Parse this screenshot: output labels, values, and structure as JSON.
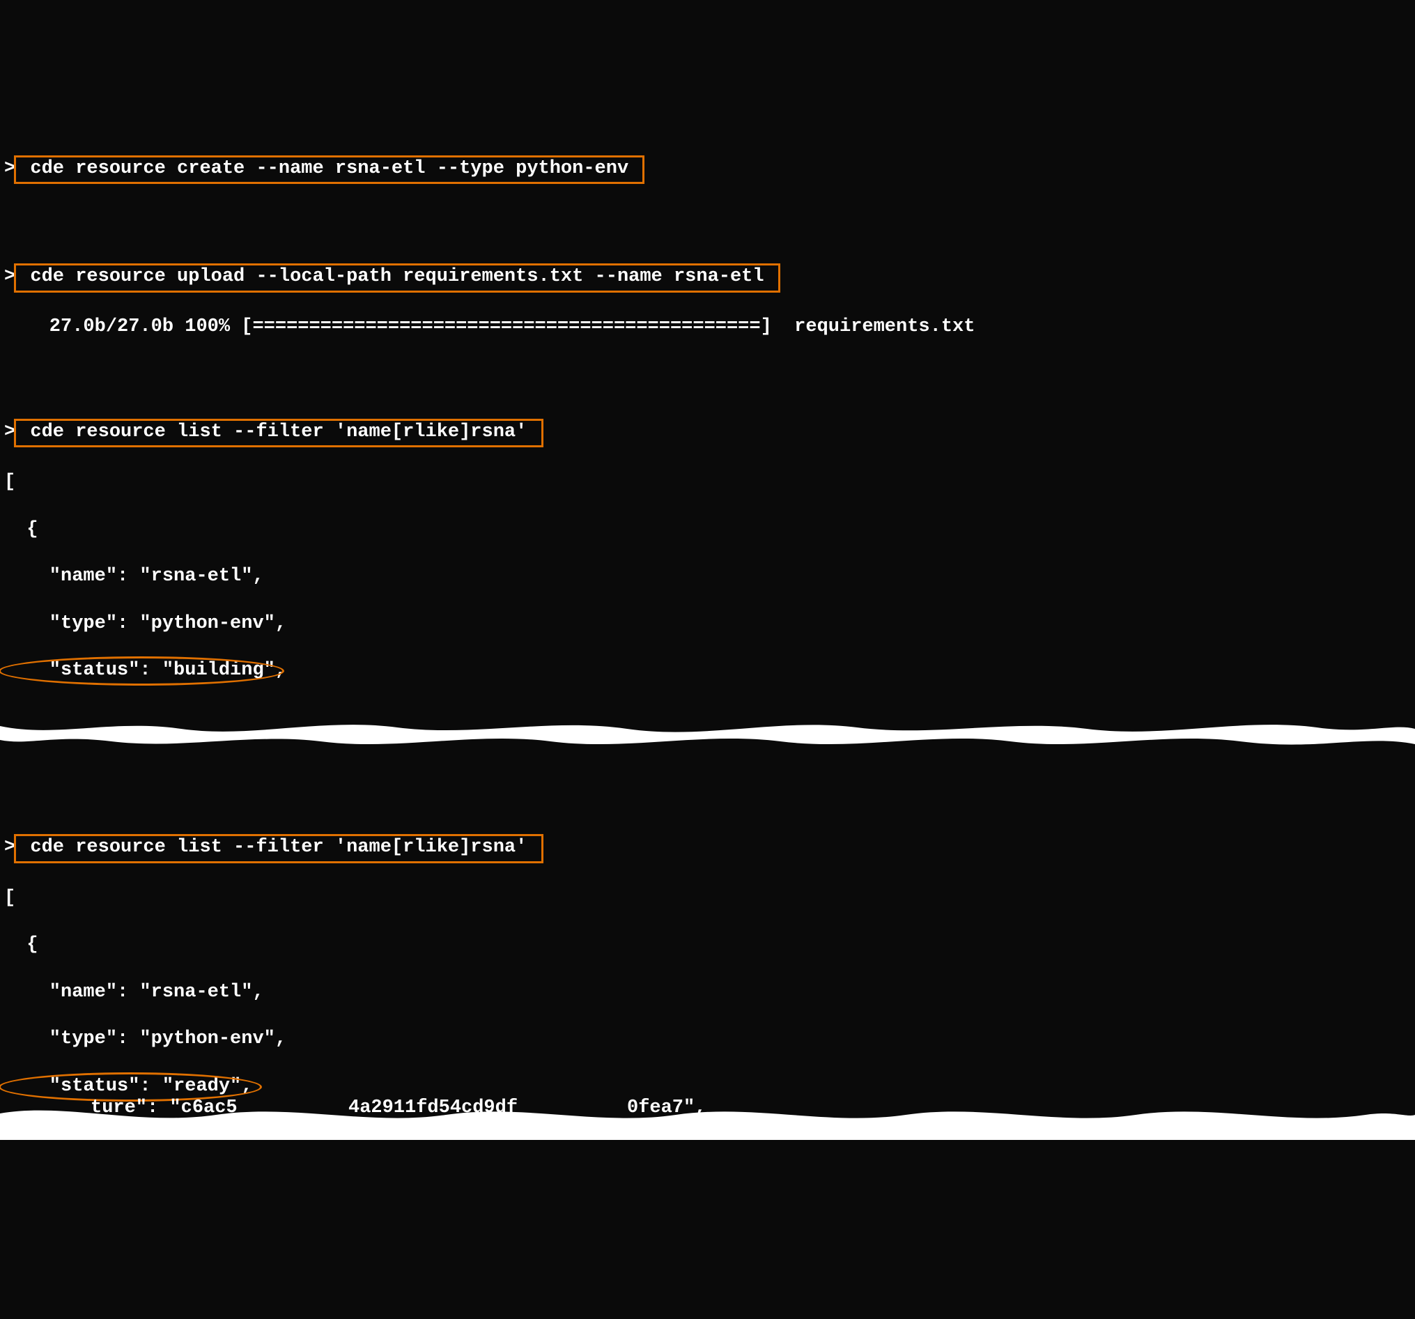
{
  "block1": {
    "prompt": ">",
    "command": " cde resource create --name rsna-etl --type python-env "
  },
  "block2": {
    "prompt": ">",
    "command": " cde resource upload --local-path requirements.txt --name rsna-etl ",
    "progress_line": "    27.0b/27.0b 100% [=============================================]  requirements.txt"
  },
  "block3": {
    "prompt": ">",
    "command": " cde resource list --filter 'name[rlike]rsna' ",
    "out_open_bracket": "[",
    "out_open_brace": "  {",
    "out_name": "    \"name\": \"rsna-etl\",",
    "out_type": "    \"type\": \"python-env\",",
    "out_status": "    \"status\": \"building\","
  },
  "block4": {
    "prompt": ">",
    "command": " cde resource list --filter 'name[rlike]rsna' ",
    "out_open_bracket": "[",
    "out_open_brace": "  {",
    "out_name": "    \"name\": \"rsna-etl\",",
    "out_type": "    \"type\": \"python-env\",",
    "out_status": "    \"status\": \"ready\",",
    "out_partial": "          ture\": \"c6ac5       4a2911fd54cd9df       0fea7\","
  }
}
